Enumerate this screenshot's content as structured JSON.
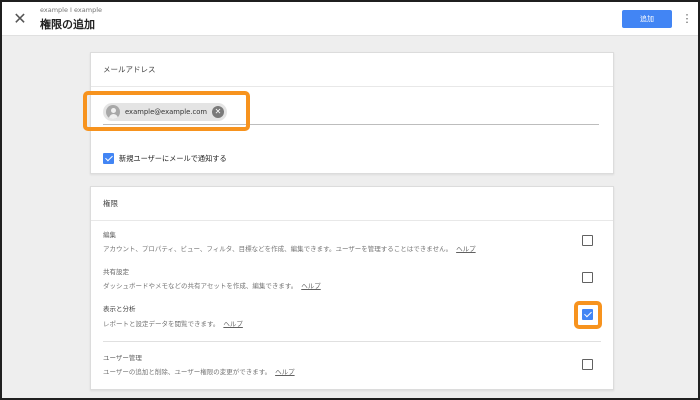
{
  "header": {
    "subtitle": "example I example",
    "title": "権限の追加",
    "add_label": "追加",
    "close_glyph": "✕",
    "more_glyph": "⋮"
  },
  "email_section": {
    "heading": "メールアドレス",
    "chip_text": "example@example.com",
    "chip_remove_glyph": "✕",
    "notify_checked": true,
    "notify_label": "新規ユーザーにメールで通知する"
  },
  "permissions": {
    "heading": "権限",
    "help_label": "ヘルプ",
    "items": [
      {
        "name": "編集",
        "description": "アカウント、プロパティ、ビュー、フィルタ、目標などを作成、編集できます。ユーザーを管理することはできません。",
        "checked": false
      },
      {
        "name": "共有設定",
        "description": "ダッシュボードやメモなどの共有アセットを作成、編集できます。",
        "checked": false
      },
      {
        "name": "表示と分析",
        "description": "レポートと設定データを閲覧できます。",
        "checked": true
      },
      {
        "name": "ユーザー管理",
        "description": "ユーザーの追加と削除、ユーザー権限の変更ができます。",
        "checked": false
      }
    ]
  },
  "colors": {
    "primary": "#4285f4",
    "highlight": "#f7931e",
    "background": "#eeeeee"
  }
}
